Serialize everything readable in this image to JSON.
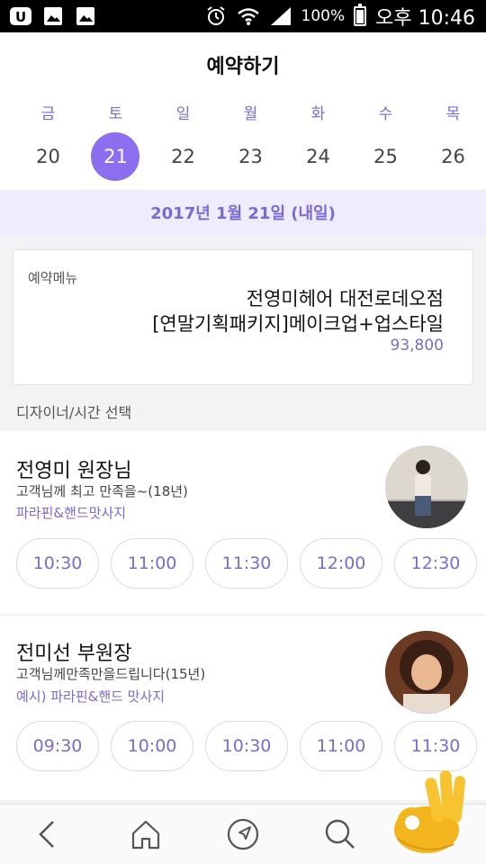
{
  "status_bar": {
    "battery": "100%",
    "time": "오후 10:46"
  },
  "header": {
    "title": "예약하기"
  },
  "calendar": {
    "weekdays": [
      "금",
      "토",
      "일",
      "월",
      "화",
      "수",
      "목"
    ],
    "dates": [
      "20",
      "21",
      "22",
      "23",
      "24",
      "25",
      "26"
    ],
    "selected": "21",
    "selected_label": "2017년 1월 21일 (내일)"
  },
  "menu": {
    "label": "예약메뉴",
    "shop": "전영미헤어 대전로데오점",
    "package": "[연말기획패키지]메이크업+업스타일",
    "price": "93,800"
  },
  "section_label": "디자이너/시간 선택",
  "designers": [
    {
      "name": "전영미 원장님",
      "desc": "고객님께 최고 만족을~(18년)",
      "tag": "파라핀&핸드맛사지",
      "slots": [
        "10:30",
        "11:00",
        "11:30",
        "12:00",
        "12:30"
      ]
    },
    {
      "name": "전미선 부원장",
      "desc": "고객님께만족만을드립니다(15년)",
      "tag": "예시) 파라핀&핸드 맛사지",
      "slots": [
        "09:30",
        "10:00",
        "10:30",
        "11:00",
        "11:30"
      ]
    }
  ],
  "colors": {
    "accent": "#8b6ff0",
    "accent_text": "#7b6ad6",
    "banner_bg": "#efecfd"
  },
  "icons": {
    "nav": [
      "back-icon",
      "home-icon",
      "navigate-icon",
      "search-icon"
    ],
    "overlay": "ok-hand-emoji"
  }
}
